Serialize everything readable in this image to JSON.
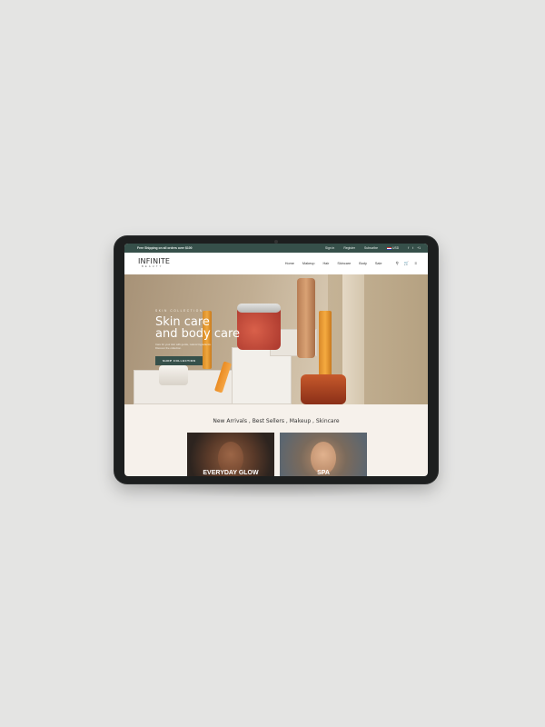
{
  "topbar": {
    "announcement": "Free Shipping on all orders over $100",
    "sign_in": "Sign in",
    "register": "Register",
    "subscribe": "Subscribe",
    "currency": "USD",
    "social": [
      "f",
      "t",
      "+1"
    ]
  },
  "header": {
    "logo": "INFINITE",
    "logo_sub": "BEAUTY",
    "nav": [
      "Home",
      "Makeup",
      "Hair",
      "Skincare",
      "Body",
      "Sale"
    ],
    "icons": [
      "search-icon",
      "cart-icon",
      "menu-icon"
    ]
  },
  "hero": {
    "eyebrow": "SKIN COLLECTION",
    "title_line1": "Skin care",
    "title_line2": "and body care",
    "subtitle": "Care for your skin with gentle, natural ingredients. Discover the collection.",
    "cta": "SHOP COLLECTION"
  },
  "categories": {
    "heading": "New Arrivals , Best Sellers , Makeup , Skincare",
    "tiles": [
      "EVERYDAY GLOW",
      "SPA"
    ]
  },
  "colors": {
    "accent": "#36504a",
    "background": "#f6f1eb"
  }
}
